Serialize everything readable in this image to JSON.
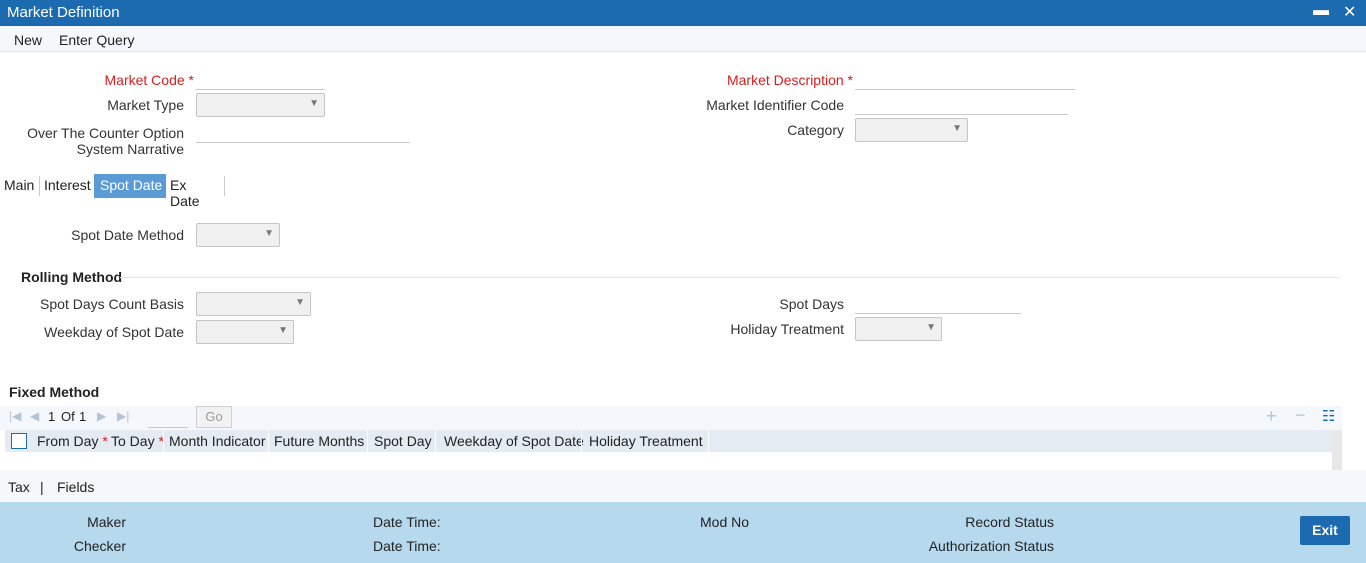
{
  "window": {
    "title": "Market Definition",
    "minimize_glyph": "▬",
    "close_glyph": "✕"
  },
  "menu": {
    "new_label": "New",
    "enter_query_label": "Enter Query"
  },
  "header": {
    "market_code_label": "Market Code",
    "market_type_label": "Market Type",
    "otc_label_line1": "Over The Counter Option",
    "otc_label_line2": "System Narrative",
    "market_description_label": "Market Description",
    "market_identifier_code_label": "Market Identifier Code",
    "category_label": "Category",
    "required_mark": "*"
  },
  "tabs": [
    "Main",
    "Interest",
    "Spot Date",
    "Ex Date"
  ],
  "spot_date": {
    "method_label": "Spot Date Method",
    "rolling_title": "Rolling Method",
    "count_basis_label": "Spot Days Count Basis",
    "weekday_label": "Weekday of Spot Date",
    "spot_days_label": "Spot Days",
    "holiday_label": "Holiday Treatment"
  },
  "fixed": {
    "title": "Fixed Method",
    "pager_current": "1",
    "pager_of": "Of",
    "pager_total": "1",
    "go_label": "Go",
    "columns": [
      "From Day",
      "To Day",
      "Month Indicator",
      "Future Months",
      "Spot Day",
      "Weekday of Spot Date",
      "Holiday Treatment"
    ]
  },
  "subtabs": {
    "tax_label": "Tax",
    "separator": "|",
    "fields_label": "Fields"
  },
  "footer": {
    "maker_label": "Maker",
    "checker_label": "Checker",
    "date_time_label": "Date Time:",
    "mod_no_label": "Mod No",
    "record_status_label": "Record Status",
    "authorization_status_label": "Authorization Status",
    "exit_label": "Exit"
  },
  "colors": {
    "title_bar": "#1c6bb0",
    "active_tab": "#5b9bd5",
    "footer": "#b7d9ee",
    "required": "#d81e1e"
  }
}
